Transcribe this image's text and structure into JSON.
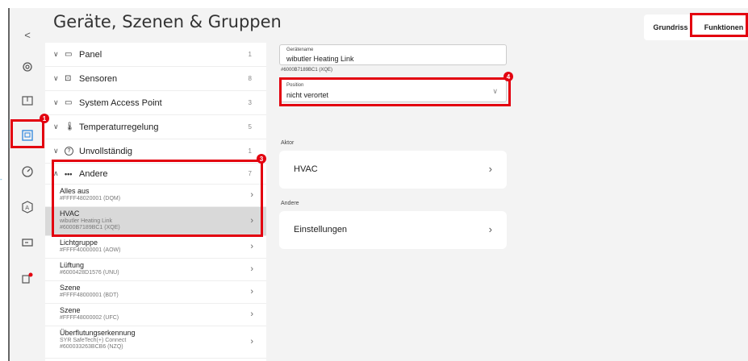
{
  "header": {
    "back_glyph": "<",
    "title": "Geräte, Szenen & Gruppen",
    "tabs": [
      {
        "label": "Grundriss"
      },
      {
        "label": "Funktionen"
      }
    ]
  },
  "sidebar": {
    "items": [
      {
        "icon": "gear-icon"
      },
      {
        "icon": "floorplan-icon"
      },
      {
        "icon": "devices-icon"
      },
      {
        "icon": "gauge-icon"
      },
      {
        "icon": "automation-icon"
      },
      {
        "icon": "panel-icon"
      },
      {
        "icon": "notification-icon"
      }
    ]
  },
  "groups": [
    {
      "label": "Panel",
      "count": "1",
      "icon": "▭"
    },
    {
      "label": "Sensoren",
      "count": "8",
      "icon": "⊡"
    },
    {
      "label": "System Access Point",
      "count": "3",
      "icon": "▭"
    },
    {
      "label": "Temperaturregelung",
      "count": "5",
      "icon": "🌡"
    },
    {
      "label": "Unvollständig",
      "count": "1",
      "icon": "?"
    },
    {
      "label": "Andere",
      "count": "7",
      "icon": "•••"
    }
  ],
  "items": [
    {
      "name": "Alles aus",
      "sub": "#FFFF48020001 (DQM)"
    },
    {
      "name": "HVAC",
      "sub": "wibutler Heating Link",
      "sub2": "#6000B7189BC1 (XQE)"
    },
    {
      "name": "Lichtgruppe",
      "sub": "#FFFF40000001 (AOW)"
    },
    {
      "name": "Lüftung",
      "sub": "#6000428D1576 (UNU)"
    },
    {
      "name": "Szene",
      "sub": "#FFFF48000001 (BDT)"
    },
    {
      "name": "Szene",
      "sub": "#FFFF48000002 (UFC)"
    },
    {
      "name": "Überflutungserkennung",
      "sub": "SYR SafeTech(+) Connect",
      "sub2": "#600033263BCB6 (NZQ)"
    }
  ],
  "detail": {
    "name_label": "Gerätename",
    "name_value": "wibutler Heating Link",
    "device_id": "#6000B7189BC1 (XQE)",
    "position_label": "Position",
    "position_value": "nicht verortet",
    "section_aktor": "Aktor",
    "card_hvac": "HVAC",
    "section_andere": "Andere",
    "card_settings": "Einstellungen"
  },
  "annotations": [
    "1",
    "3",
    "4"
  ],
  "colors": {
    "highlight": "#e3000f",
    "selected_row": "#d9d9d9",
    "background": "#f3f3f3"
  }
}
